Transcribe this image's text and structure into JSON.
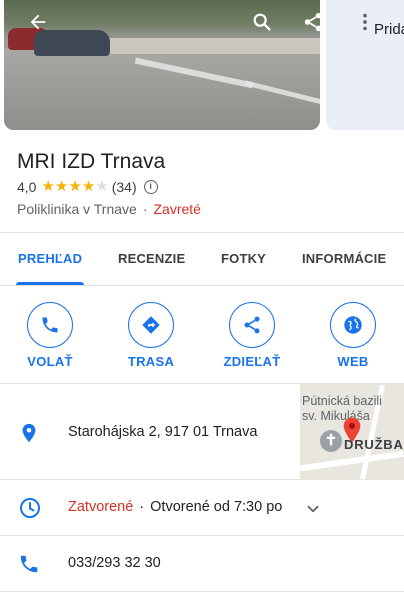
{
  "header": {
    "side_label": "Prida"
  },
  "place": {
    "title": "MRI IZD Trnava",
    "rating": "4,0",
    "rating_value": 4.0,
    "rating_max": 5,
    "review_count": "(34)",
    "category": "Poliklinika v Trnave",
    "separator": "·",
    "status": "Zavreté"
  },
  "tabs": [
    {
      "label": "PREHĽAD",
      "active": true
    },
    {
      "label": "RECENZIE",
      "active": false
    },
    {
      "label": "FOTKY",
      "active": false
    },
    {
      "label": "INFORMÁCIE",
      "active": false
    }
  ],
  "actions": [
    {
      "label": "VOLAŤ",
      "icon": "phone-icon"
    },
    {
      "label": "TRASA",
      "icon": "directions-icon"
    },
    {
      "label": "ZDIEĽAŤ",
      "icon": "share-icon"
    },
    {
      "label": "WEB",
      "icon": "globe-icon"
    }
  ],
  "address": {
    "text": "Starohájska 2, 917 01 Trnava",
    "icon": "location-pin-icon"
  },
  "map": {
    "line1": "Pútnická bazili",
    "line2": "sv. Mikuláša",
    "line3": "DRUŽBA"
  },
  "hours": {
    "status": "Zatvorené",
    "separator": "·",
    "detail": "Otvorené od 7:30 po",
    "icon": "clock-icon"
  },
  "phone": {
    "number": "033/293 32 30",
    "icon": "phone-icon"
  },
  "colors": {
    "accent": "#1a73e8",
    "closed": "#d93025",
    "star": "#f4b400"
  }
}
